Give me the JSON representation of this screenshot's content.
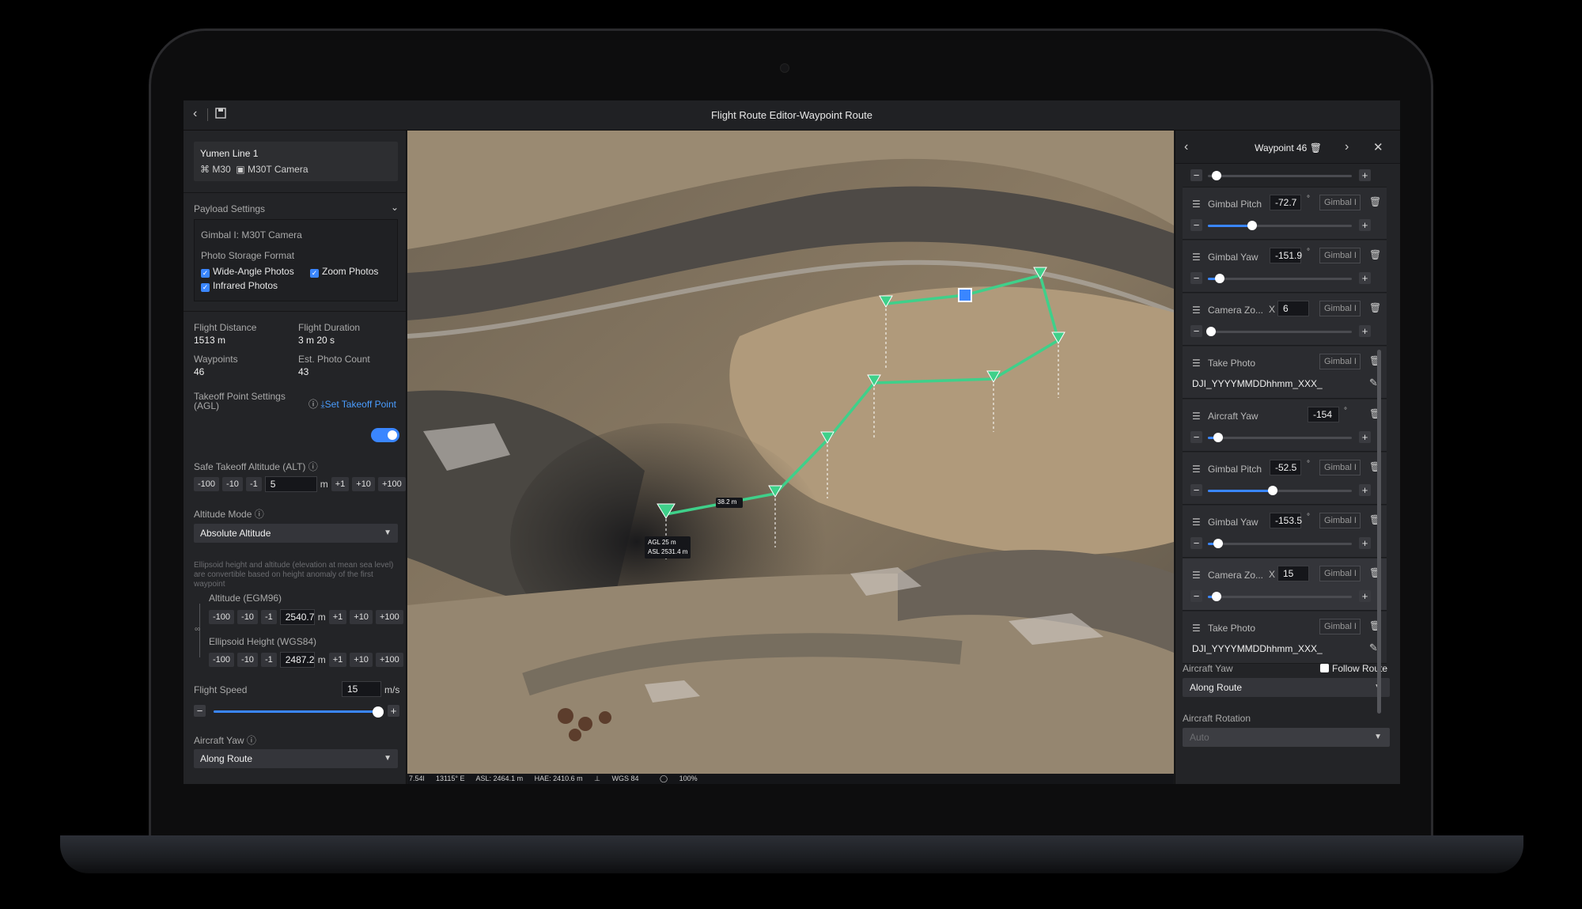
{
  "titlebar": {
    "title": "Flight Route Editor-Waypoint Route"
  },
  "route": {
    "name": "Yumen Line 1",
    "aircraft": "M30",
    "camera": "M30T Camera"
  },
  "payload": {
    "section_title": "Payload Settings",
    "gimbal": "Gimbal I: M30T Camera",
    "storage_label": "Photo Storage Format",
    "wide": "Wide-Angle Photos",
    "zoom": "Zoom Photos",
    "infrared": "Infrared Photos"
  },
  "stats": {
    "distance_label": "Flight Distance",
    "distance": "1513 m",
    "duration_label": "Flight Duration",
    "duration": "3 m 20 s",
    "waypoints_label": "Waypoints",
    "waypoints": "46",
    "photos_label": "Est. Photo Count",
    "photos": "43"
  },
  "takeoff": {
    "label_1": "Takeoff Point Settings",
    "label_2": "(AGL)",
    "link": "Set Takeoff Point",
    "safe_label": "Safe Takeoff Altitude (ALT)",
    "safe_value": "5",
    "unit": "m"
  },
  "steps": {
    "m100": "-100",
    "m10": "-10",
    "m1": "-1",
    "p1": "+1",
    "p10": "+10",
    "p100": "+100"
  },
  "altitude": {
    "mode_label": "Altitude Mode",
    "mode_value": "Absolute Altitude",
    "hint": "Ellipsoid height and altitude (elevation at mean sea level) are convertible based on height anomaly of the first waypoint",
    "egm_label": "Altitude (EGM96)",
    "egm_value": "2540.7",
    "wgs_label": "Ellipsoid Height (WGS84)",
    "wgs_value": "2487.2",
    "unit": "m"
  },
  "speed": {
    "label": "Flight Speed",
    "value": "15",
    "unit": "m/s",
    "slider_fraction": 0.98
  },
  "left_yaw": {
    "label": "Aircraft Yaw",
    "value": "Along Route"
  },
  "map": {
    "segment_label": "38.2 m",
    "agl": "AGL 25 m",
    "asl": "ASL 2531.4 m"
  },
  "status_bar": {
    "lat": "7.54l",
    "lon": "13115° E",
    "asl": "ASL: 2464.1 m",
    "hae": "HAE: 2410.6 m",
    "datum": "WGS 84",
    "zoom": "100%"
  },
  "right_panel": {
    "title": "Waypoint 46",
    "top_slider_fraction": 0.06,
    "actions": [
      {
        "label": "Gimbal Pitch",
        "value": "-72.7",
        "gimbal": "Gimbal I",
        "slider": 0.31,
        "type": "value"
      },
      {
        "label": "Gimbal Yaw",
        "value": "-151.9",
        "gimbal": "Gimbal I",
        "slider": 0.08,
        "type": "value"
      },
      {
        "label": "Camera Zo...",
        "value": "6",
        "gimbal": "Gimbal I",
        "slider": 0.02,
        "type": "zoom",
        "x": "X"
      },
      {
        "label": "Take Photo",
        "gimbal": "Gimbal I",
        "file": "DJI_YYYYMMDDhhmm_XXX_",
        "type": "photo"
      },
      {
        "label": "Aircraft Yaw",
        "value": "-154",
        "slider": 0.07,
        "type": "yaw"
      },
      {
        "label": "Gimbal Pitch",
        "value": "-52.5",
        "gimbal": "Gimbal I",
        "slider": 0.45,
        "type": "value"
      },
      {
        "label": "Gimbal Yaw",
        "value": "-153.5",
        "gimbal": "Gimbal I",
        "slider": 0.07,
        "type": "value"
      },
      {
        "label": "Camera Zo...",
        "value": "15",
        "gimbal": "Gimbal I",
        "slider": 0.06,
        "type": "zoom",
        "x": "X",
        "active": true
      },
      {
        "label": "Take Photo",
        "gimbal": "Gimbal I",
        "file": "DJI_YYYYMMDDhhmm_XXX_",
        "type": "photo"
      }
    ],
    "yaw_label": "Aircraft Yaw",
    "follow_route": "Follow Route",
    "yaw_value": "Along Route",
    "rotation_label": "Aircraft Rotation",
    "rotation_value": "Auto"
  },
  "colors": {
    "accent": "#3a86ff",
    "route": "#3fd08a"
  }
}
